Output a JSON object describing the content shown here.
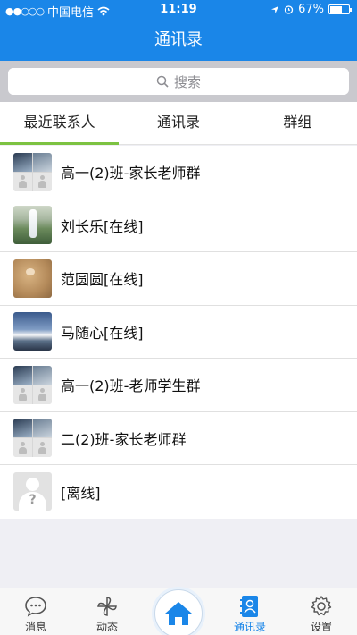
{
  "status_bar": {
    "carrier": "中国电信",
    "time": "11:19",
    "battery": "67%",
    "battery_level": 0.67
  },
  "nav": {
    "title": "通讯录"
  },
  "search": {
    "placeholder": "搜索"
  },
  "tabs": [
    {
      "label": "最近联系人",
      "active": true
    },
    {
      "label": "通讯录",
      "active": false
    },
    {
      "label": "群组",
      "active": false
    }
  ],
  "contacts": [
    {
      "name": "高一(2)班-家长老师群",
      "avatar": "group-avatar"
    },
    {
      "name": "刘长乐[在线]",
      "avatar": "waterfall-photo-avatar"
    },
    {
      "name": "范圆圆[在线]",
      "avatar": "sand-photo-avatar"
    },
    {
      "name": "马随心[在线]",
      "avatar": "mountain-photo-avatar"
    },
    {
      "name": "高一(2)班-老师学生群",
      "avatar": "group-avatar"
    },
    {
      "name": "二(2)班-家长老师群",
      "avatar": "group-avatar"
    },
    {
      "name": "[离线]",
      "avatar": "unknown-user-avatar"
    }
  ],
  "tabbar": {
    "items": [
      {
        "label": "消息",
        "icon": "chat-bubble-icon"
      },
      {
        "label": "动态",
        "icon": "pinwheel-icon"
      },
      {
        "label": "",
        "icon": "home-icon"
      },
      {
        "label": "通讯录",
        "icon": "contacts-book-icon",
        "active": true
      },
      {
        "label": "设置",
        "icon": "gear-icon"
      }
    ]
  },
  "colors": {
    "primary": "#1a86e8",
    "tab_indicator": "#7cc241"
  }
}
